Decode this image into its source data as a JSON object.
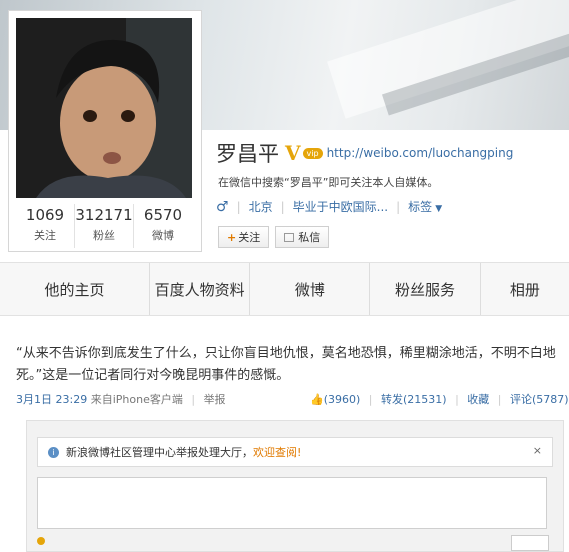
{
  "profile": {
    "name": "罗昌平",
    "verified_mark": "V",
    "vip_badge": "vip",
    "url": "http://weibo.com/luochangping",
    "bio": "在微信中搜索“罗昌平”即可关注本人自媒体。",
    "gender_icon": "♂",
    "location": "北京",
    "education": "毕业于中欧国际...",
    "tags_label": "标签",
    "tags_arrow": "▼",
    "follow_plus": "+",
    "follow_label": "关注",
    "message_label": "私信",
    "stats": [
      {
        "num": "1069",
        "label": "关注"
      },
      {
        "num": "312171",
        "label": "粉丝"
      },
      {
        "num": "6570",
        "label": "微博"
      }
    ]
  },
  "tabs": [
    "他的主页",
    "百度人物资料",
    "微博",
    "粉丝服务",
    "相册"
  ],
  "post": {
    "text": "“从来不告诉你到底发生了什么，只让你盲目地仇恨，莫名地恐惧，稀里糊涂地活，不明不白地死。”这是一位记者同行对今晚昆明事件的感慨。",
    "time": "3月1日 23:29",
    "source": "来自iPhone客户端",
    "report": "举报",
    "likes": "(3960)",
    "repost": "转发(21531)",
    "favorite": "收藏",
    "comment": "评论(5787)"
  },
  "comment_area": {
    "notice_icon": "i",
    "notice_text": "新浪微博社区管理中心举报处理大厅，",
    "notice_link": "欢迎查阅!",
    "close": "×"
  },
  "colors": {
    "link": "#3a6ea5",
    "accent": "#e07a00",
    "vip": "#e5a50a"
  }
}
